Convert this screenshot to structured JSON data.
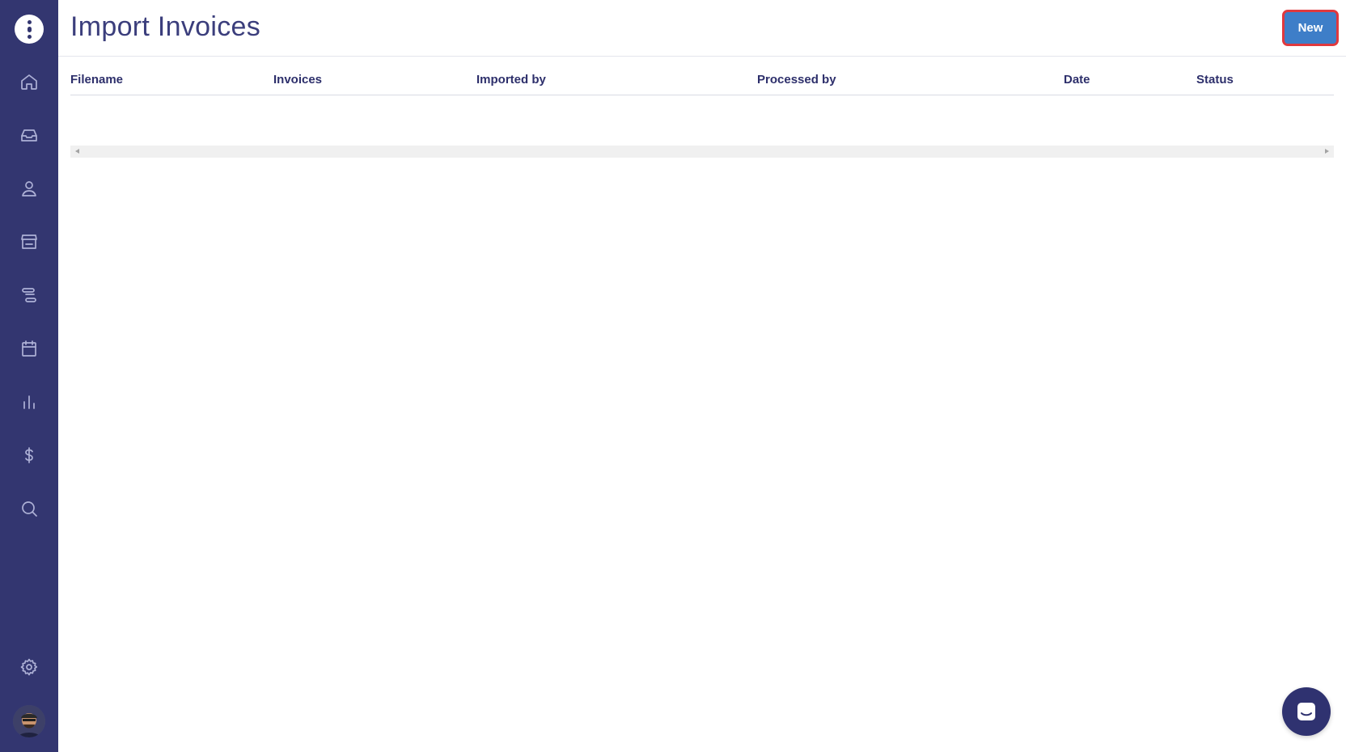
{
  "page": {
    "title": "Import Invoices"
  },
  "toolbar": {
    "new_label": "New"
  },
  "table": {
    "columns": [
      "Filename",
      "Invoices",
      "Imported by",
      "Processed by",
      "Date",
      "Status"
    ],
    "rows": []
  },
  "sidebar": {
    "items": [
      {
        "icon": "home-icon"
      },
      {
        "icon": "inbox-icon"
      },
      {
        "icon": "user-icon"
      },
      {
        "icon": "store-icon"
      },
      {
        "icon": "timeline-icon"
      },
      {
        "icon": "calendar-icon"
      },
      {
        "icon": "bar-chart-icon"
      },
      {
        "icon": "dollar-icon"
      },
      {
        "icon": "search-icon"
      }
    ],
    "bottom": [
      {
        "icon": "gear-icon"
      },
      {
        "icon": "avatar"
      }
    ]
  },
  "colors": {
    "sidebar": "#333670",
    "accent_button": "#3e7ec8",
    "button_highlight_border": "#e0393e",
    "title_text": "#3b3e7c"
  }
}
